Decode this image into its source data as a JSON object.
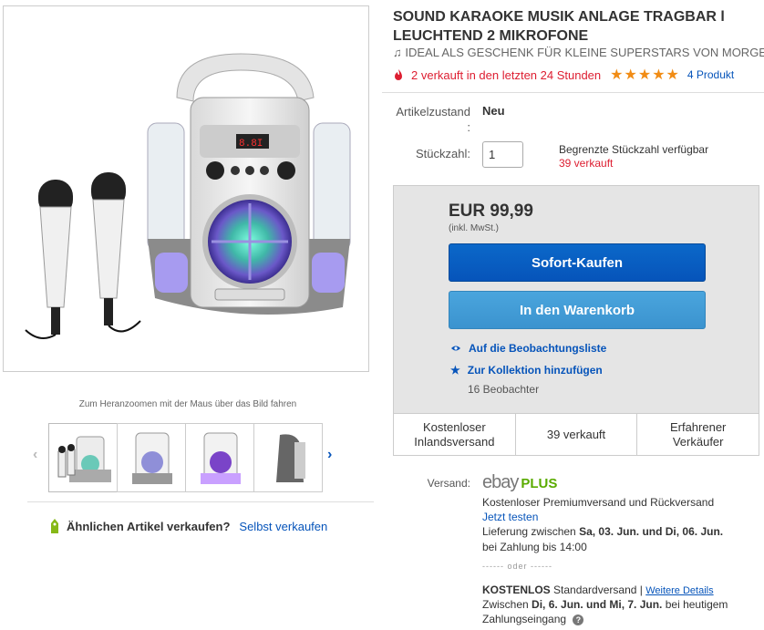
{
  "gallery": {
    "zoom_hint": "Zum Heranzoomen mit der Maus über das Bild fahren",
    "sell_label": "Ähnlichen Artikel verkaufen?",
    "sell_link": "Selbst verkaufen"
  },
  "item": {
    "title_line1": "SOUND KARAOKE MUSIK ANLAGE TRAGBAR l",
    "title_line2": "LEUCHTEND 2 MIKROFONE",
    "subtitle": "IDEAL ALS GESCHENK FÜR KLEINE SUPERSTARS VON MORGE",
    "sold_recent": "2 verkauft in den letzten 24 Stunden",
    "stars": "★★★★★",
    "rating": 5,
    "reviews": "4 Produkt"
  },
  "condition": {
    "label_line1": "Artikelzustand",
    "label_line2": ":",
    "value": "Neu"
  },
  "quantity": {
    "label": "Stückzahl:",
    "value": "1",
    "info": "Begrenzte Stückzahl verfügbar",
    "sold": "39 verkauft"
  },
  "buybox": {
    "price": "EUR 99,99",
    "price_note": "(inkl. MwSt.)",
    "buy_now": "Sofort-Kaufen",
    "add_to_cart": "In den Warenkorb",
    "watchlist": "Auf die Beobachtungsliste",
    "collection": "Zur Kollektion hinzufügen",
    "watchers": "16 Beobachter",
    "stats": [
      {
        "line1": "Kostenloser",
        "line2": "Inlandsversand"
      },
      {
        "line1": "39 verkauft",
        "line2": ""
      },
      {
        "line1": "Erfahrener",
        "line2": "Verkäufer"
      }
    ]
  },
  "shipping": {
    "label": "Versand:",
    "ebay": "ebay",
    "plus": "PLUS",
    "premium": "Kostenloser Premiumversand und Rückversand",
    "try_link": "Jetzt testen",
    "delivery_prefix": "Lieferung zwischen",
    "delivery_range": "Sa, 03. Jun. und Di, 06. Jun.",
    "payment": "bei Zahlung bis 14:00",
    "oder": "------ oder ------",
    "free": "KOSTENLOS",
    "standard": "Standardversand |",
    "details_link": "Weitere Details",
    "between_prefix": "Zwischen",
    "between_range": "Di, 6. Jun. und Mi, 7. Jun.",
    "between_suffix": "bei heutigem",
    "payment_receipt": "Zahlungseingang"
  },
  "colors": {
    "link": "#0654ba",
    "alert": "#dd1e31",
    "star": "#f18c15",
    "buy_button": "#0654ba",
    "cart_button": "#3b93cf",
    "plus_green": "#5aab00"
  }
}
